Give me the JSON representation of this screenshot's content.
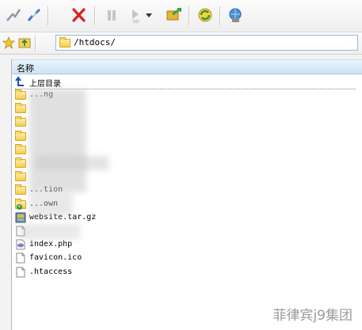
{
  "toolbar": {
    "buttons": [
      {
        "name": "connect-icon"
      },
      {
        "name": "disconnect-icon"
      },
      {
        "name": "cancel-icon"
      },
      {
        "name": "pause-icon"
      },
      {
        "name": "resume-icon"
      },
      {
        "name": "sync-icon"
      },
      {
        "name": "refresh-icon"
      },
      {
        "name": "site-manager-icon"
      }
    ]
  },
  "address": {
    "path": "/htdocs/"
  },
  "file_list": {
    "column_name": "名称",
    "parent_label": "上层目录",
    "rows": [
      {
        "label": "...ng",
        "type": "folder"
      },
      {
        "label": "",
        "type": "folder"
      },
      {
        "label": "",
        "type": "folder"
      },
      {
        "label": "",
        "type": "folder"
      },
      {
        "label": "",
        "type": "folder"
      },
      {
        "label": "",
        "type": "folder"
      },
      {
        "label": "",
        "type": "folder"
      },
      {
        "label": "...tion",
        "type": "folder"
      },
      {
        "label": "...own",
        "type": "folder-plus"
      },
      {
        "label": "website.tar.gz",
        "type": "archive"
      },
      {
        "label": "",
        "type": "file"
      },
      {
        "label": "index.php",
        "type": "php"
      },
      {
        "label": "favicon.ico",
        "type": "file"
      },
      {
        "label": ".htaccess",
        "type": "file"
      }
    ]
  },
  "watermark": "菲律宾j9集团"
}
